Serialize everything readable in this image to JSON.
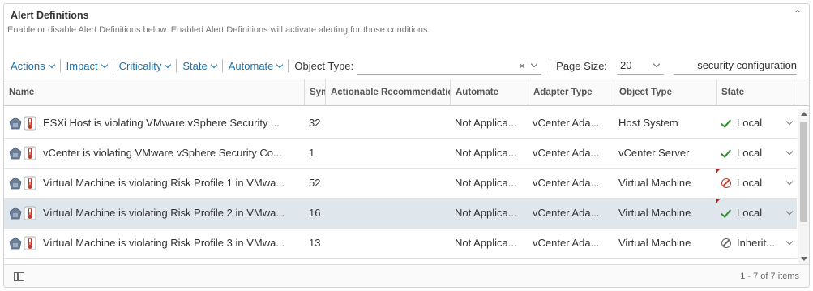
{
  "header": {
    "title": "Alert Definitions",
    "description": "Enable or disable Alert Definitions below. Enabled Alert Definitions will activate alerting for those conditions.",
    "collapse_icon": "double-chevron-up-icon"
  },
  "toolbar": {
    "actions": "Actions",
    "impact": "Impact",
    "criticality": "Criticality",
    "state": "State",
    "automate": "Automate",
    "object_type_label": "Object Type:",
    "object_type_value": "",
    "page_size_label": "Page Size:",
    "page_size_value": "20",
    "search_value": "security configuration"
  },
  "columns": {
    "name": "Name",
    "symptoms": "Sym",
    "actionable": "Actionable Recommendatio",
    "automate": "Automate",
    "adapter_type": "Adapter Type",
    "object_type": "Object Type",
    "state": "State"
  },
  "rows": [
    {
      "name": "ESXi Host is violating VMware vSphere Security ...",
      "symptoms": "32",
      "actionable": "",
      "automate": "Not Applica...",
      "adapter_type": "vCenter Ada...",
      "object_type": "Host System",
      "state": "Local",
      "state_icon": "check-icon",
      "flag": false,
      "selected": false
    },
    {
      "name": "vCenter is violating VMware vSphere Security Co...",
      "symptoms": "1",
      "actionable": "",
      "automate": "Not Applica...",
      "adapter_type": "vCenter Ada...",
      "object_type": "vCenter Server",
      "state": "Local",
      "state_icon": "check-icon",
      "flag": false,
      "selected": false
    },
    {
      "name": "Virtual Machine is violating Risk Profile 1 in VMwa...",
      "symptoms": "52",
      "actionable": "",
      "automate": "Not Applica...",
      "adapter_type": "vCenter Ada...",
      "object_type": "Virtual Machine",
      "state": "Local",
      "state_icon": "no-entry-icon",
      "flag": true,
      "selected": false
    },
    {
      "name": "Virtual Machine is violating Risk Profile 2 in VMwa...",
      "symptoms": "16",
      "actionable": "",
      "automate": "Not Applica...",
      "adapter_type": "vCenter Ada...",
      "object_type": "Virtual Machine",
      "state": "Local",
      "state_icon": "check-icon",
      "flag": true,
      "selected": true
    },
    {
      "name": "Virtual Machine is violating Risk Profile 3 in VMwa...",
      "symptoms": "13",
      "actionable": "",
      "automate": "Not Applica...",
      "adapter_type": "vCenter Ada...",
      "object_type": "Virtual Machine",
      "state": "Inherit...",
      "state_icon": "inherit-icon",
      "flag": false,
      "selected": false
    }
  ],
  "footer": {
    "count": "1 - 7 of 7 items"
  },
  "colors": {
    "link": "#1a73b0",
    "check": "#2e8b2e",
    "disabled": "#c0392b",
    "selected_row": "#dfe6ec"
  }
}
